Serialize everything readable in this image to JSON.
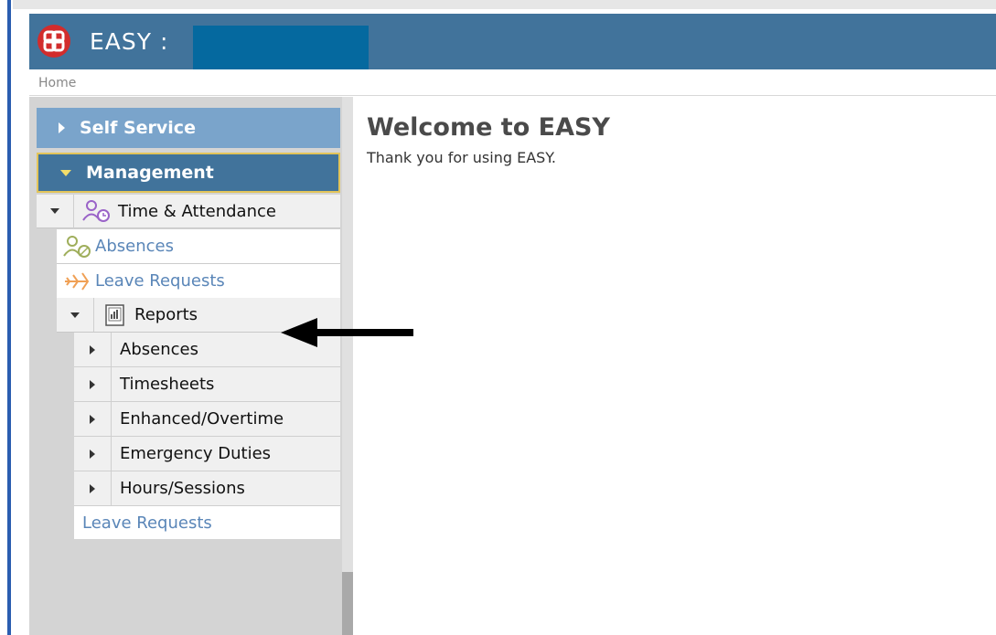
{
  "header": {
    "app_title": "EASY :"
  },
  "breadcrumb": {
    "home": "Home"
  },
  "sidebar": {
    "self_service": "Self Service",
    "management": "Management",
    "time_attendance": "Time & Attendance",
    "absences": "Absences",
    "leave_requests": "Leave Requests",
    "reports": "Reports",
    "report_items": [
      "Absences",
      "Timesheets",
      "Enhanced/Overtime",
      "Emergency Duties",
      "Hours/Sessions"
    ],
    "leave_requests_2": "Leave Requests"
  },
  "main": {
    "title": "Welcome to EASY",
    "subtitle": "Thank you for using EASY."
  },
  "colors": {
    "header": "#41739b",
    "accordion_active": "#41739b",
    "accordion_inactive": "#7aa4cb",
    "link": "#5a86b8"
  }
}
